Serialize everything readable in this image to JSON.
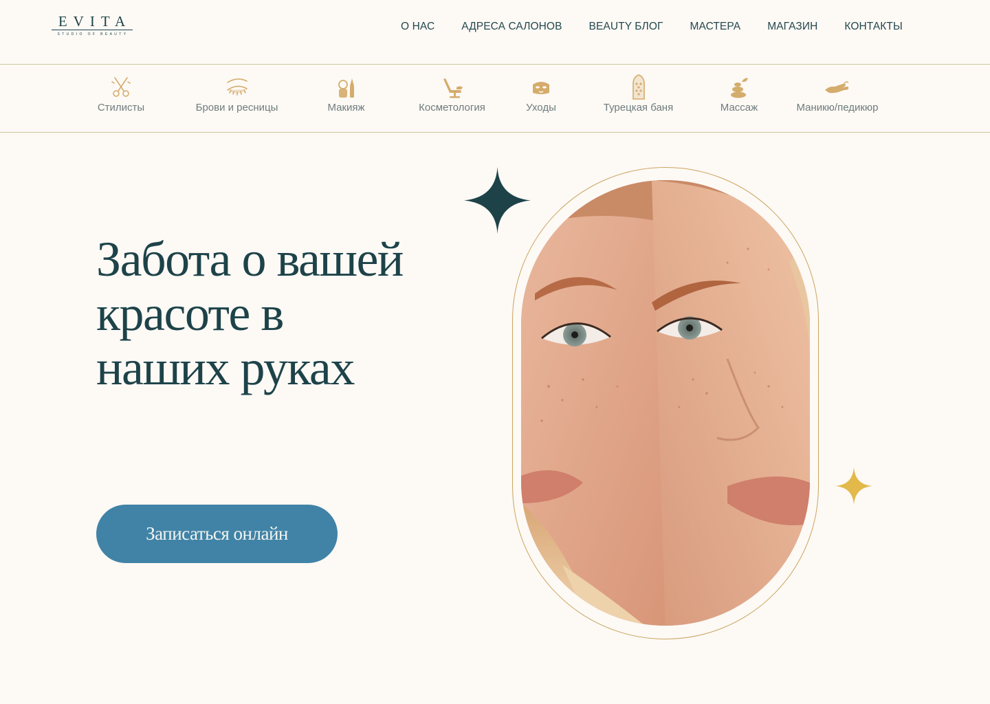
{
  "brand": {
    "name": "EVITA",
    "tagline": "STUDIO OF BEAUTY"
  },
  "nav": {
    "items": [
      {
        "label": "О НАС"
      },
      {
        "label": "АДРЕСА САЛОНОВ"
      },
      {
        "label": "BEAUTY БЛОГ"
      },
      {
        "label": "МАСТЕРА"
      },
      {
        "label": "МАГАЗИН"
      },
      {
        "label": "КОНТАКТЫ"
      }
    ]
  },
  "services": [
    {
      "label": "Стилисты",
      "icon": "scissors-icon"
    },
    {
      "label": "Брови и ресницы",
      "icon": "eyelash-icon"
    },
    {
      "label": "Макияж",
      "icon": "makeup-icon"
    },
    {
      "label": "Косметология",
      "icon": "beauty-chair-icon"
    },
    {
      "label": "Уходы",
      "icon": "face-mask-icon"
    },
    {
      "label": "Турецкая баня",
      "icon": "hammam-icon"
    },
    {
      "label": "Массаж",
      "icon": "massage-stones-icon"
    },
    {
      "label": "Маникю/педикюр",
      "icon": "hand-icon"
    }
  ],
  "hero": {
    "title": "Забота о вашей красоте в наших руках",
    "cta_label": "Записаться онлайн",
    "photo_alt": "two-women-faces-photo"
  },
  "colors": {
    "background": "#fdf9f5",
    "primary_text": "#1d4349",
    "cta": "#4083a6",
    "gold": "#c9a45e",
    "sparkle_dark": "#1d4349",
    "sparkle_gold": "#e2b94a"
  }
}
